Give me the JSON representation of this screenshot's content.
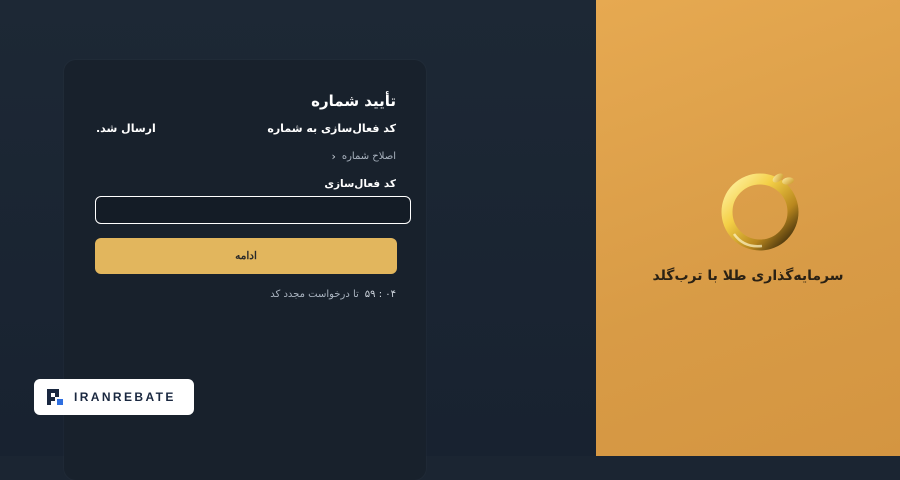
{
  "verify": {
    "title": "تأیید شماره",
    "code_sent_prefix": "کد فعال‌سازی به شماره",
    "code_sent_suffix": "ارسال شد.",
    "edit_number": "اصلاح شماره",
    "code_label": "کد فعال‌سازی",
    "code_value": "",
    "continue_label": "ادامه",
    "timer_value": "۵۹ : ۰۴",
    "timer_text": "تا درخواست مجدد کد"
  },
  "brand": {
    "tagline": "سرمایه‌گذاری طلا با ترب‌گلد",
    "logo_icon": "gold-ring-logo-icon"
  },
  "watermark": {
    "text": "IRANREBATE",
    "icon": "iranrebate-logo-icon"
  },
  "colors": {
    "accent_button": "#e2b65d",
    "gold_panel": "#e0a44e",
    "card_bg": "#18212c",
    "page_bg": "#1b2532"
  }
}
